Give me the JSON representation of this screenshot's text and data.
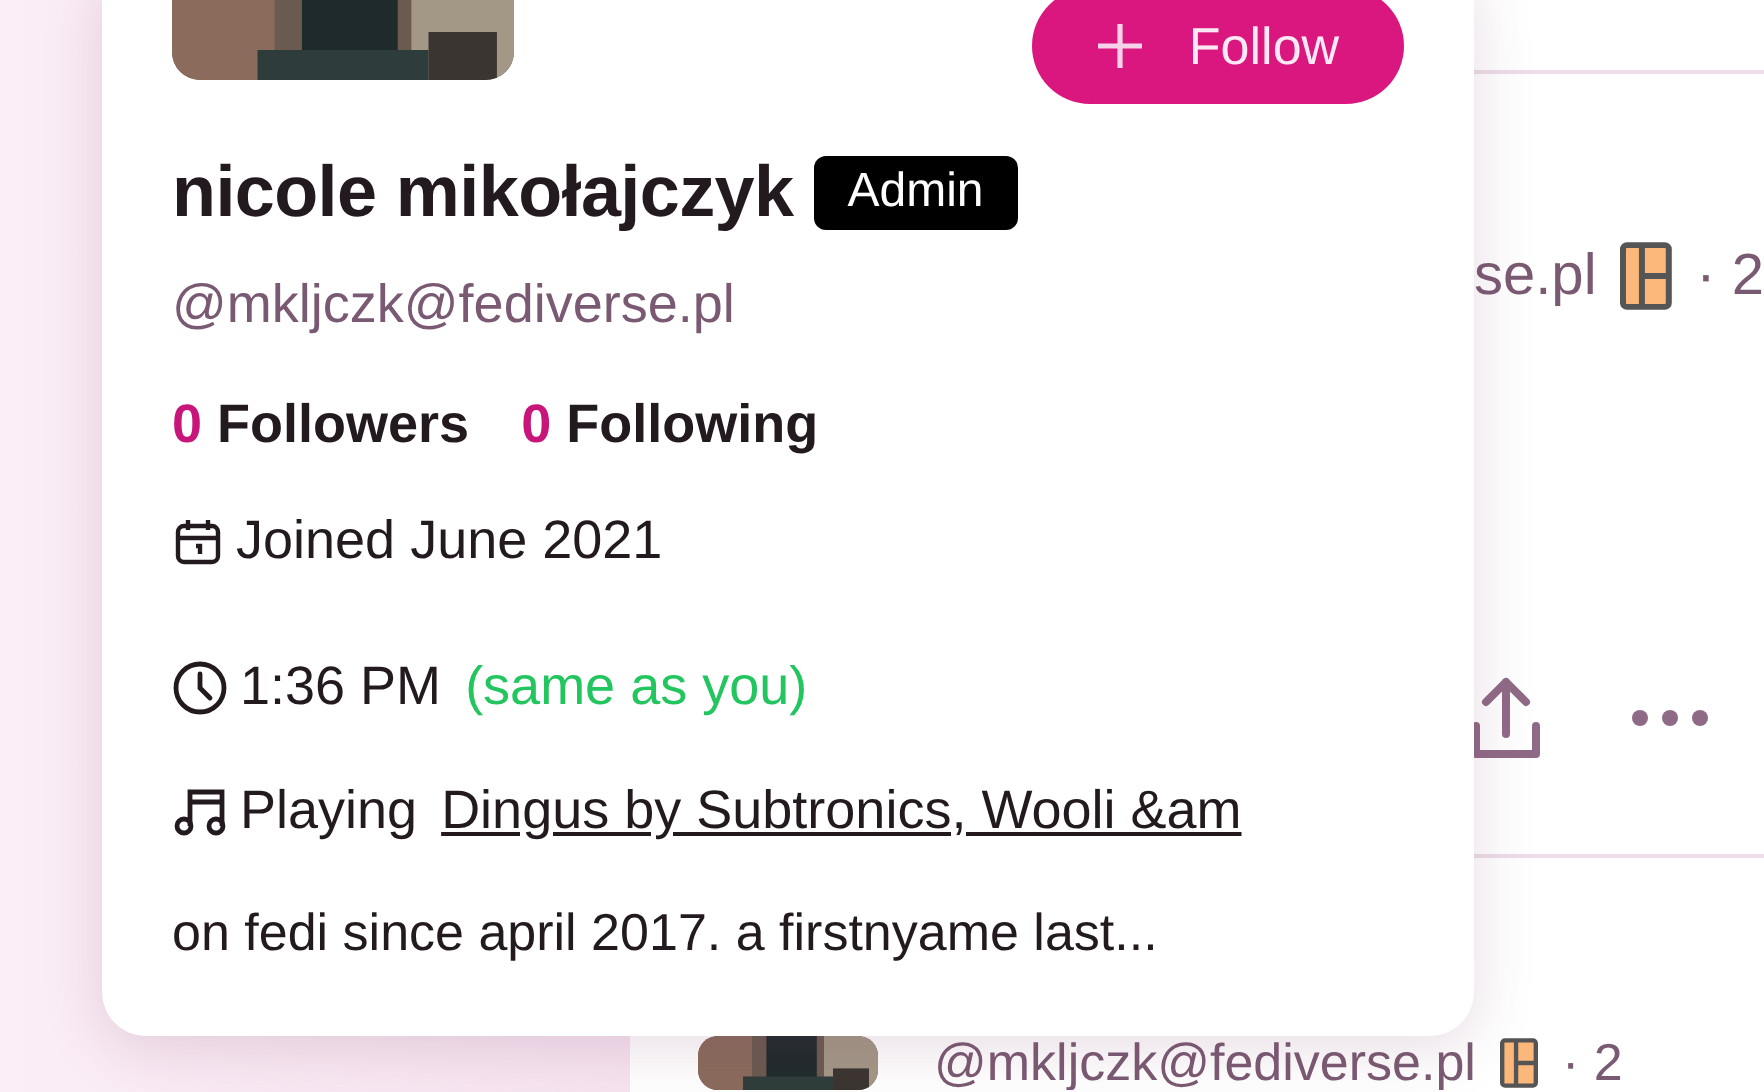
{
  "feed": {
    "posts": [
      {
        "handle": "se.pl",
        "meta": "· 2"
      },
      {
        "handle": "@mkljczk@fediverse.pl",
        "meta": "· 2"
      }
    ]
  },
  "profile_card": {
    "follow_button": {
      "label": "Follow"
    },
    "name": "nicole mikołajczyk",
    "badge": "Admin",
    "handle": "@mkljczk@fediverse.pl",
    "stats": [
      {
        "count": "0",
        "label": "Followers"
      },
      {
        "count": "0",
        "label": "Following"
      }
    ],
    "joined": "Joined June 2021",
    "local_time": {
      "time": "1:36 PM",
      "note": "(same as you)"
    },
    "now_playing": {
      "prefix": "Playing",
      "link": "Dingus by Subtronics, Wooli &am"
    },
    "bio": "on fedi since april 2017. a firstnyame last..."
  }
}
